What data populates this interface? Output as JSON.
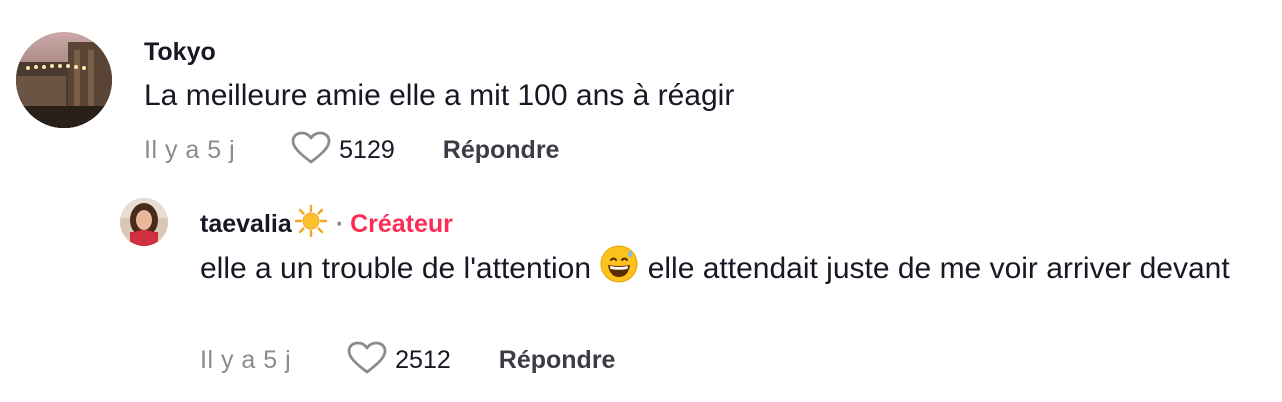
{
  "comments": [
    {
      "username": "Tokyo",
      "text": "La meilleure amie elle a mit 100 ans à réagir",
      "timestamp": "Il y a 5 j",
      "likes": "5129",
      "reply_label": "Répondre",
      "avatar_icon": "user-avatar-photo"
    }
  ],
  "reply": {
    "username": "taevalia",
    "username_emoji": "sun-icon",
    "separator": "·",
    "badge": "Créateur",
    "text_before": "elle a un trouble de l'attention ",
    "text_emoji": "grinning-sweat-emoji",
    "text_after": " elle attendait juste de me voir arriver devant",
    "timestamp": "Il y a 5 j",
    "likes": "2512",
    "reply_label": "Répondre",
    "avatar_icon": "user-avatar-photo"
  },
  "colors": {
    "text": "#161823",
    "muted": "#8a8b91",
    "creator": "#fe2c55"
  }
}
